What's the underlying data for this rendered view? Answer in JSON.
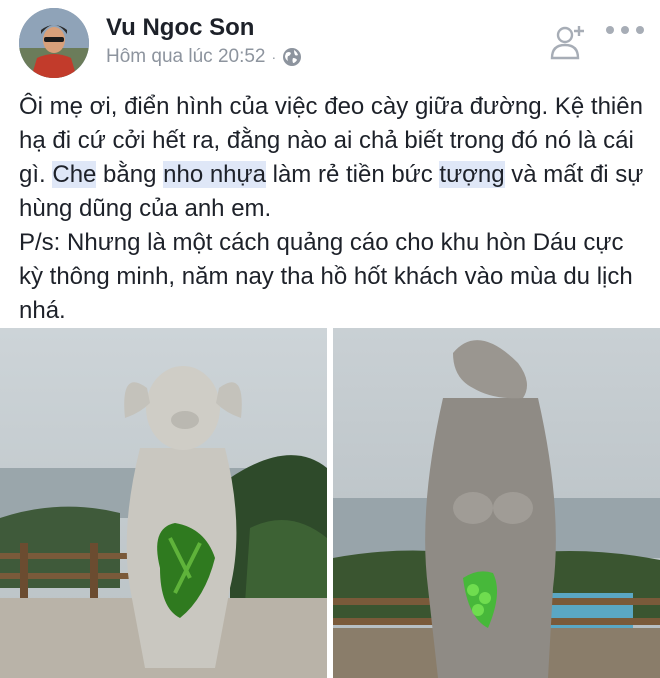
{
  "post": {
    "author": "Vu Ngoc Son",
    "timestamp": "Hôm qua lúc 20:52",
    "separator": "·",
    "privacy_icon": "globe-icon",
    "add_friend_icon": "add-friend-icon",
    "more_icon": "more-dots-icon",
    "text": {
      "p1_a": "Ôi mẹ ơi, điển hình của việc đeo cày giữa đường. Kệ thiên hạ đi cứ cởi hết ra, đằng nào ai chả biết trong đó nó là cái gì. ",
      "p1_h1": "Che",
      "p1_b": " bằng ",
      "p1_h2": "nho nhựa",
      "p1_c": " làm rẻ tiền bức ",
      "p1_h3": "tượng",
      "p1_d": " và mất đi sự hùng dũng của anh em.",
      "p2": "P/s: Nhưng là một cách quảng cáo cho khu hòn Dáu cực kỳ thông minh, năm nay tha hồ hốt khách vào mùa du lịch nhá."
    },
    "photos": [
      {
        "subject": "pig-headed statue with leaf cover"
      },
      {
        "subject": "lizard-headed statue with grape cover"
      }
    ]
  },
  "colors": {
    "text": "#1d2129",
    "meta": "#8d949e",
    "highlight": "#dfe7f7",
    "icon": "#a7adb6"
  }
}
